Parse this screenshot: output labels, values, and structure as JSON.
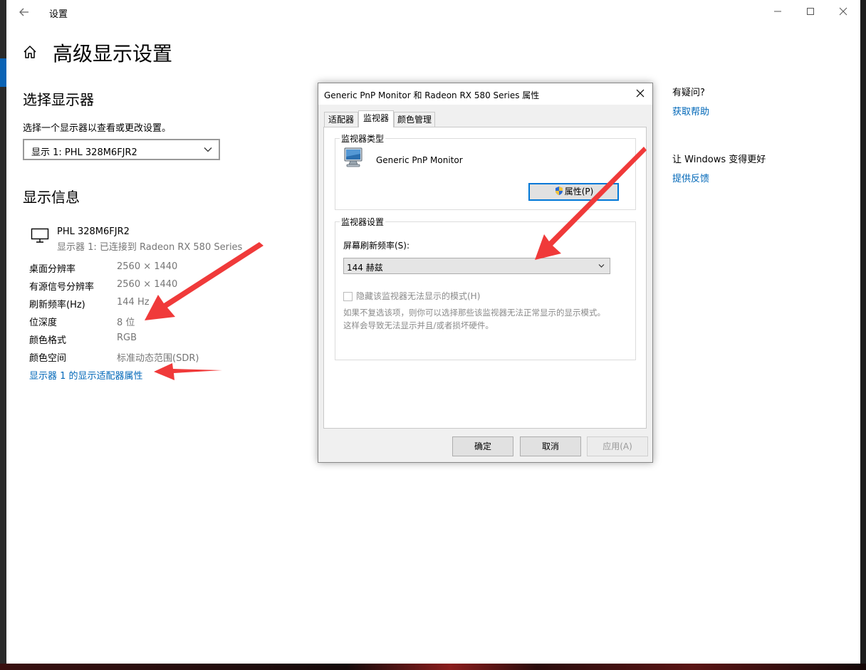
{
  "window": {
    "title": "设置"
  },
  "page": {
    "title": "高级显示设置"
  },
  "select_display": {
    "heading": "选择显示器",
    "prompt": "选择一个显示器以查看或更改设置。",
    "selected": "显示 1: PHL 328M6FJR2"
  },
  "display_info": {
    "heading": "显示信息",
    "monitor_name": "PHL 328M6FJR2",
    "monitor_sub": "显示器 1: 已连接到 Radeon RX 580 Series",
    "rows": [
      {
        "label": "桌面分辨率",
        "value": "2560 × 1440"
      },
      {
        "label": "有源信号分辨率",
        "value": "2560 × 1440"
      },
      {
        "label": "刷新频率(Hz)",
        "value": "144 Hz"
      },
      {
        "label": "位深度",
        "value": "8 位"
      },
      {
        "label": "颜色格式",
        "value": "RGB"
      },
      {
        "label": "颜色空间",
        "value": "标准动态范围(SDR)"
      }
    ],
    "adapter_link": "显示器 1 的显示适配器属性"
  },
  "sidebar": {
    "question": "有疑问?",
    "help_link": "获取帮助",
    "improve": "让 Windows 变得更好",
    "feedback_link": "提供反馈"
  },
  "dialog": {
    "title": "Generic PnP Monitor 和 Radeon RX 580 Series 属性",
    "tabs": [
      {
        "label": "适配器"
      },
      {
        "label": "监视器"
      },
      {
        "label": "颜色管理"
      }
    ],
    "active_tab": "监视器",
    "monitor_type": {
      "legend": "监视器类型",
      "name": "Generic PnP Monitor",
      "properties_button": "属性(P)"
    },
    "monitor_settings": {
      "legend": "监视器设置",
      "refresh_label": "屏幕刷新频率(S):",
      "refresh_value": "144 赫兹",
      "hide_modes_label": "隐藏该监视器无法显示的模式(H)",
      "hide_modes_checked": false,
      "note_line1": "如果不复选该项，则你可以选择那些该监视器无法正常显示的显示模式。",
      "note_line2": "这样会导致无法显示并且/或者损坏硬件。"
    },
    "buttons": {
      "ok": "确定",
      "cancel": "取消",
      "apply": "应用(A)"
    }
  },
  "colors": {
    "link": "#0067b8",
    "annotation_arrow": "#f03a3a",
    "focus_border": "#0078d7"
  }
}
